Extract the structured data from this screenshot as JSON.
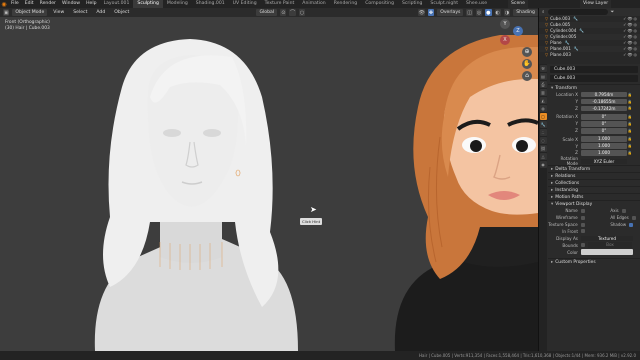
{
  "topbar": {
    "menus": [
      "File",
      "Edit",
      "Render",
      "Window",
      "Help"
    ],
    "workspace_tabs": [
      "Layout.001",
      "Sculpting",
      "Modeling",
      "Shading.001",
      "UV Editing",
      "Texture Paint",
      "Animation",
      "Rendering",
      "Compositing",
      "Scripting",
      "Sculpt.night",
      "Shee.use"
    ],
    "active_tab_index": 1,
    "scene_label": "Scene",
    "view_layer_label": "View Layer"
  },
  "viewport_header": {
    "mode": "Object Mode",
    "menus": [
      "View",
      "Select",
      "Add",
      "Object"
    ],
    "orientation": "Global",
    "overlays": "Overlays",
    "shading": "Shading"
  },
  "viewport": {
    "view_name": "Front (Orthographic)",
    "collection_info": "(30) Hair | Cube.003",
    "tooltip": "Click Hint",
    "gizmo_labels": [
      "Y",
      "Z",
      "X"
    ]
  },
  "outliner": {
    "search_placeholder": "",
    "rows": [
      {
        "name": "Cube.003",
        "selected": false
      },
      {
        "name": "Cube.005",
        "selected": false
      },
      {
        "name": "Cylinder.004",
        "selected": false
      },
      {
        "name": "Cylinder.005",
        "selected": false
      },
      {
        "name": "Plane",
        "selected": false
      },
      {
        "name": "Plane.001",
        "selected": true
      },
      {
        "name": "Plane.003",
        "selected": false
      }
    ]
  },
  "properties": {
    "object_name": "Cube.003",
    "transform_title": "Transform",
    "location_label": "Location X",
    "location": [
      "0.7954m",
      "-0.18655m",
      "-0.17242m"
    ],
    "rotation_label": "Rotation X",
    "rotation": [
      "0°",
      "0°",
      "0°"
    ],
    "scale_label": "Scale X",
    "scale": [
      "1.000",
      "1.000",
      "1.000"
    ],
    "axis_labels": [
      "Y",
      "Z"
    ],
    "rotation_mode_label": "Rotation Mode",
    "rotation_mode": "XYZ Euler",
    "sections": [
      "Delta Transform",
      "Relations",
      "Collections",
      "Instancing",
      "Motion Paths",
      "Viewport Display"
    ],
    "viewport_display": {
      "name_label": "Name",
      "axis_label": "Axis",
      "wireframe_label": "Wireframe",
      "all_edges_label": "All Edges",
      "texture_space_label": "Texture Space",
      "shadow_label": "Shadow",
      "in_front_label": "In Front",
      "display_as_label": "Display As",
      "display_as": "Textured",
      "bounds_label": "Bounds",
      "bounds_value": "Box",
      "color_label": "Color",
      "color": "#cfcfcf"
    },
    "custom_properties": "Custom Properties"
  },
  "statusbar": {
    "text": "Hair | Cube.005 | Verts:911,354 | Faces:1,558,464 | Tris:1,610,368 | Objects:1/44 | Mem: 936.2 MiB | v2.92.0"
  },
  "colors": {
    "accent": "#ea8d24",
    "selection": "#334d80",
    "viewport_bg": "#3d3d3d",
    "skin": "#f6c8a8",
    "hair": "#d98a4e"
  }
}
